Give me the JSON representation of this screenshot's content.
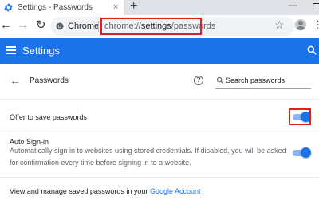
{
  "browser": {
    "tab": {
      "title": "Settings - Passwords",
      "close": "×"
    },
    "new_tab": "+",
    "window": {
      "minimize": "—"
    },
    "nav": {
      "back": "←",
      "forward": "→",
      "reload": "↻"
    },
    "omnibox": {
      "site_label": "Chrome",
      "url_prefix": "chrome://",
      "url_main": "settings",
      "url_suffix": "/passwords"
    },
    "bookmark_star": "☆",
    "menu": "⋮"
  },
  "settings": {
    "title": "Settings"
  },
  "passwords": {
    "back": "←",
    "title": "Passwords",
    "help": "?",
    "search": {
      "placeholder": "Search passwords"
    },
    "offer_to_save": {
      "label": "Offer to save passwords",
      "enabled": true
    },
    "auto_signin": {
      "label": "Auto Sign-in",
      "description_line1": "Automatically sign in to websites using stored credentials. If disabled, you will be asked",
      "description_line2": "for confirmation every time before signing in to a website.",
      "enabled": true
    },
    "manage": {
      "text": "View and manage saved passwords in your ",
      "link": "Google Account"
    }
  },
  "colors": {
    "accent": "#1a73e8",
    "highlight": "#e21e1e"
  }
}
